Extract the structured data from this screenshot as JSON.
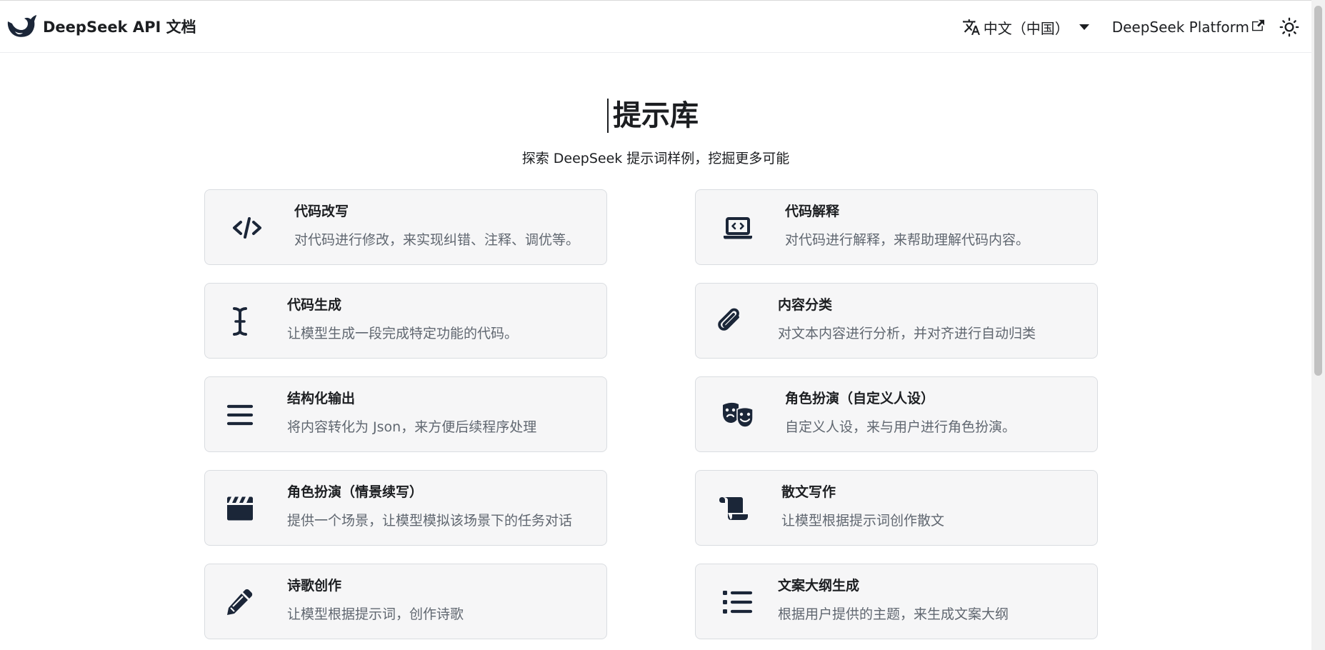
{
  "navbar": {
    "brand_title": "DeepSeek API 文档",
    "language": "中文（中国）",
    "platform_link": "DeepSeek Platform"
  },
  "page": {
    "title": "提示库",
    "subtitle": "探索 DeepSeek 提示词样例，挖掘更多可能"
  },
  "cards": [
    {
      "title": "代码改写",
      "desc": "对代码进行修改，来实现纠错、注释、调优等。",
      "icon": "code-icon"
    },
    {
      "title": "代码解释",
      "desc": "对代码进行解释，来帮助理解代码内容。",
      "icon": "laptop-code-icon"
    },
    {
      "title": "代码生成",
      "desc": "让模型生成一段完成特定功能的代码。",
      "icon": "text-cursor-icon"
    },
    {
      "title": "内容分类",
      "desc": "对文本内容进行分析，并对齐进行自动归类",
      "icon": "paperclip-icon"
    },
    {
      "title": "结构化输出",
      "desc": "将内容转化为 Json，来方便后续程序处理",
      "icon": "menu-lines-icon"
    },
    {
      "title": "角色扮演（自定义人设）",
      "desc": "自定义人设，来与用户进行角色扮演。",
      "icon": "theater-masks-icon"
    },
    {
      "title": "角色扮演（情景续写）",
      "desc": "提供一个场景，让模型模拟该场景下的任务对话",
      "icon": "clapperboard-icon"
    },
    {
      "title": "散文写作",
      "desc": "让模型根据提示词创作散文",
      "icon": "scroll-icon"
    },
    {
      "title": "诗歌创作",
      "desc": "让模型根据提示词，创作诗歌",
      "icon": "pencil-icon"
    },
    {
      "title": "文案大纲生成",
      "desc": "根据用户提供的主题，来生成文案大纲",
      "icon": "list-icon"
    }
  ],
  "colors": {
    "card_background": "#f6f6f7",
    "card_border": "#dadde1",
    "icon_color": "#1b2638",
    "description_color": "#606770"
  }
}
